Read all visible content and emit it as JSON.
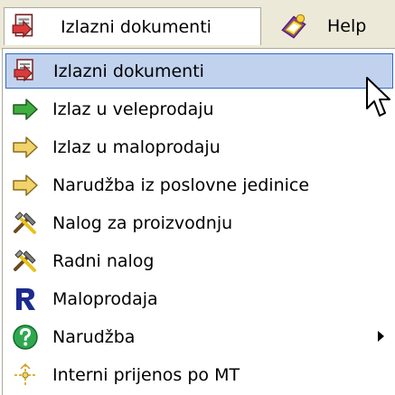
{
  "menubar": {
    "items": [
      {
        "label": "Izlazni dokumenti",
        "icon": "document-out-icon"
      },
      {
        "label": "Help",
        "icon": "help-book-icon"
      }
    ]
  },
  "dropdown": {
    "items": [
      {
        "label": "Izlazni dokumenti",
        "icon": "document-out-icon",
        "highlighted": true
      },
      {
        "label": "Izlaz u veleprodaju",
        "icon": "green-arrow-right-icon"
      },
      {
        "label": "Izlaz u maloprodaju",
        "icon": "yellow-arrow-right-icon"
      },
      {
        "label": "Narudžba iz poslovne jedinice",
        "icon": "yellow-arrow-right-icon"
      },
      {
        "label": "Nalog za proizvodnju",
        "icon": "tools-icon"
      },
      {
        "label": "Radni nalog",
        "icon": "tools-icon"
      },
      {
        "label": "Maloprodaja",
        "icon": "letter-r-icon"
      },
      {
        "label": "Narudžba",
        "icon": "question-icon",
        "has_submenu": true
      },
      {
        "label": "Interni prijenos po MT",
        "icon": "transfer-icon"
      }
    ]
  },
  "colors": {
    "menubar_bg": "#ece9d8",
    "highlight_bg": "#c1d2ee",
    "highlight_border": "#316ac5"
  }
}
